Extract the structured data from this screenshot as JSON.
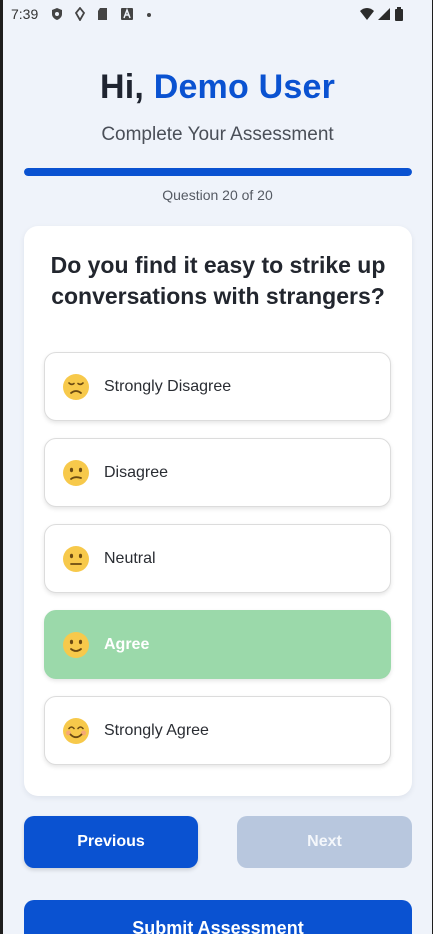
{
  "status_bar": {
    "time": "7:39"
  },
  "header": {
    "greeting_prefix": "Hi,",
    "user_name": "Demo User",
    "subtitle": "Complete Your Assessment"
  },
  "progress": {
    "fraction": 1.0,
    "counter_text": "Question 20 of 20"
  },
  "question": {
    "text": "Do you find it easy to strike up conversations with strangers?"
  },
  "options": [
    {
      "label": "Strongly Disagree",
      "emoji": "disappointed-face",
      "selected": false
    },
    {
      "label": "Disagree",
      "emoji": "confused-face",
      "selected": false
    },
    {
      "label": "Neutral",
      "emoji": "neutral-face",
      "selected": false
    },
    {
      "label": "Agree",
      "emoji": "slightly-smiling-face",
      "selected": true
    },
    {
      "label": "Strongly Agree",
      "emoji": "smiling-face",
      "selected": false
    }
  ],
  "navigation": {
    "previous_label": "Previous",
    "next_label": "Next",
    "next_enabled": false,
    "submit_label": "Submit Assessment"
  },
  "colors": {
    "accent": "#0a52d1",
    "selected_option": "#9bd9aa",
    "disabled_button": "#b8c7de",
    "background": "#eff3fa"
  }
}
